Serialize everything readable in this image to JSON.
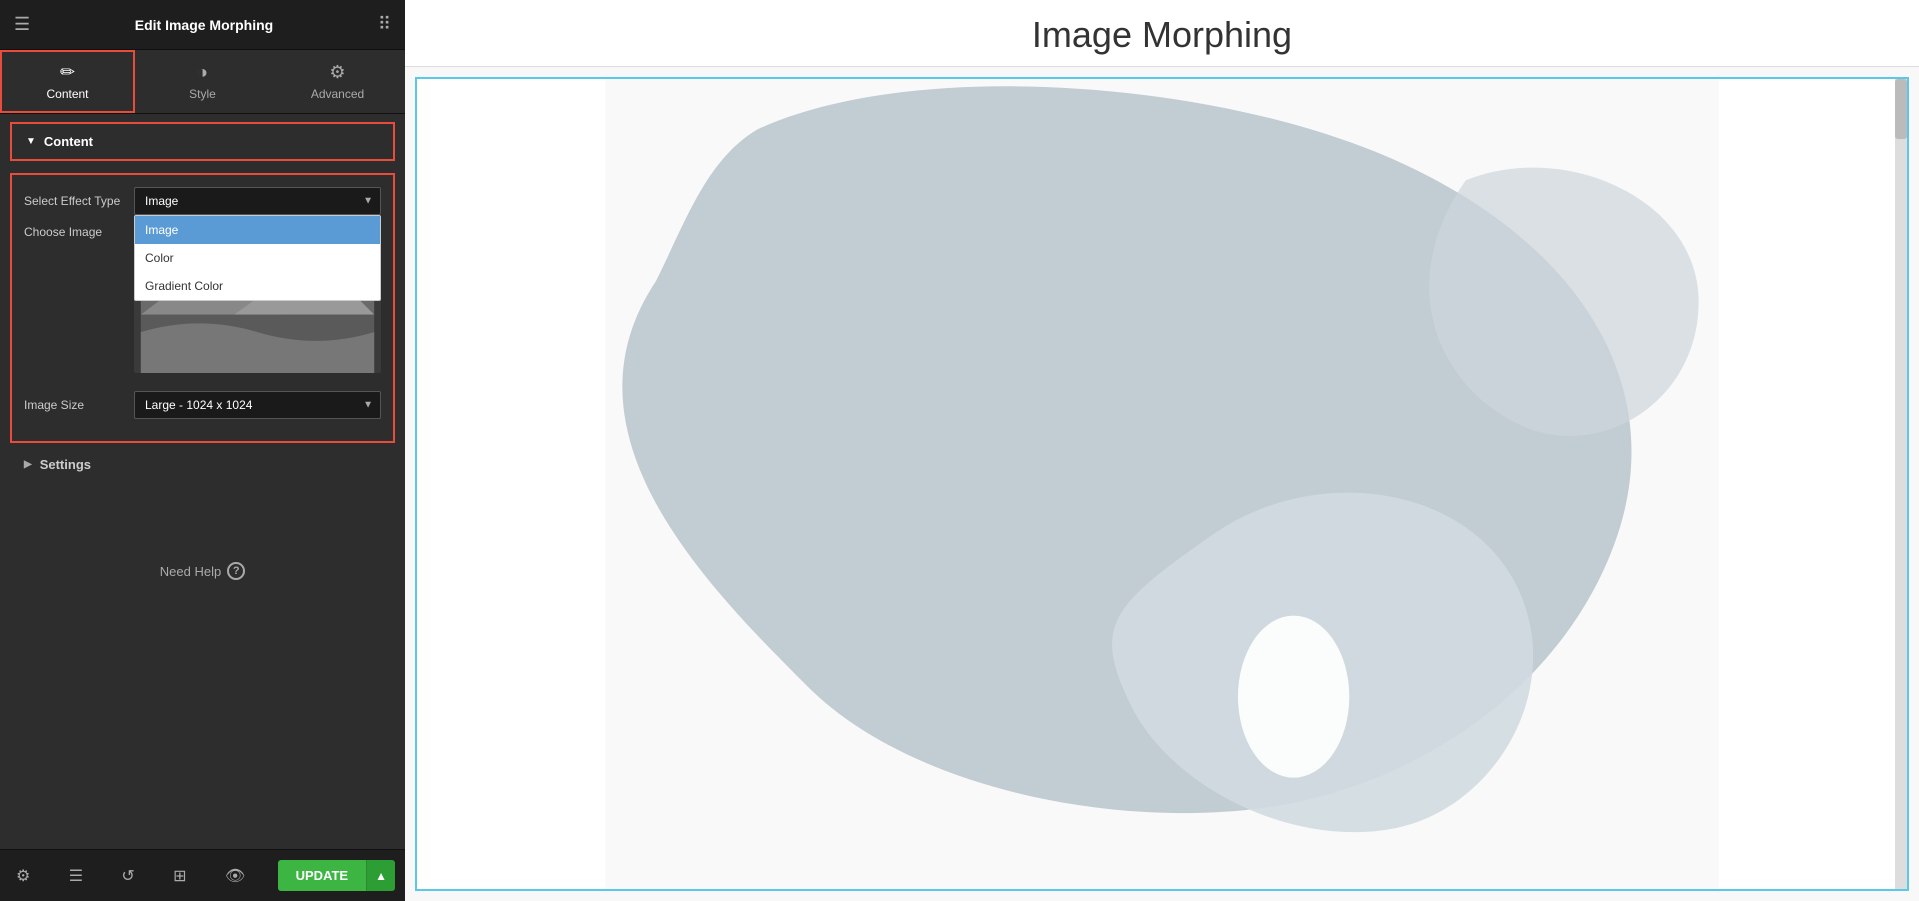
{
  "header": {
    "title": "Edit Image Morphing",
    "hamburger": "☰",
    "grid": "⋮⋮⋮"
  },
  "tabs": [
    {
      "id": "content",
      "label": "Content",
      "icon": "✏️",
      "active": true
    },
    {
      "id": "style",
      "label": "Style",
      "icon": "◑"
    },
    {
      "id": "advanced",
      "label": "Advanced",
      "icon": "⚙"
    }
  ],
  "content_section": {
    "label": "Content",
    "collapsed": false
  },
  "form": {
    "effect_type_label": "Select Effect Type",
    "effect_type_value": "Image",
    "effect_type_options": [
      {
        "value": "Image",
        "label": "Image",
        "selected": true
      },
      {
        "value": "Color",
        "label": "Color",
        "selected": false
      },
      {
        "value": "Gradient Color",
        "label": "Gradient Color",
        "selected": false
      }
    ],
    "choose_image_label": "Choose Image",
    "image_size_label": "Image Size",
    "image_size_value": "Large - 1024 x 1024"
  },
  "settings_section": {
    "label": "Settings"
  },
  "need_help": {
    "text": "Need Help",
    "icon": "?"
  },
  "bottom_toolbar": {
    "icons": [
      "⚙",
      "☰",
      "↺",
      "⊞",
      "👁"
    ],
    "update_label": "UPDATE",
    "update_arrow": "▲"
  },
  "main": {
    "title": "Image Morphing"
  }
}
